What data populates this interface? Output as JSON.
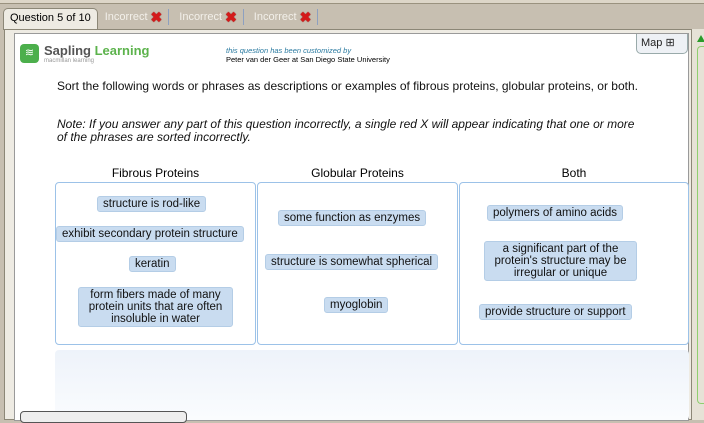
{
  "tabs": {
    "current": "Question 5 of 10",
    "attempts": [
      "Incorrect",
      "Incorrect",
      "Incorrect"
    ]
  },
  "logo": {
    "name_a": "Sapling",
    "name_b": "Learning",
    "sub": "macmillan learning"
  },
  "customized": {
    "line1": "this question has been customized by",
    "line2": "Peter van der Geer at San Diego State University"
  },
  "map_label": "Map",
  "question": "Sort the following words or phrases as descriptions or examples of fibrous proteins, globular proteins, or both.",
  "note": "Note: If you answer any part of this question incorrectly, a single red X will appear indicating that one or more of the phrases are sorted incorrectly.",
  "columns": [
    {
      "title": "Fibrous Proteins",
      "items": [
        "structure is rod-like",
        "exhibit secondary protein structure",
        "keratin",
        "form fibers made of many protein units that are often insoluble in water"
      ]
    },
    {
      "title": "Globular Proteins",
      "items": [
        "some function as enzymes",
        "structure is somewhat spherical",
        "myoglobin"
      ]
    },
    {
      "title": "Both",
      "items": [
        "polymers of amino acids",
        "a significant part of the protein's structure may be irregular or unique",
        "provide structure or support"
      ]
    }
  ]
}
